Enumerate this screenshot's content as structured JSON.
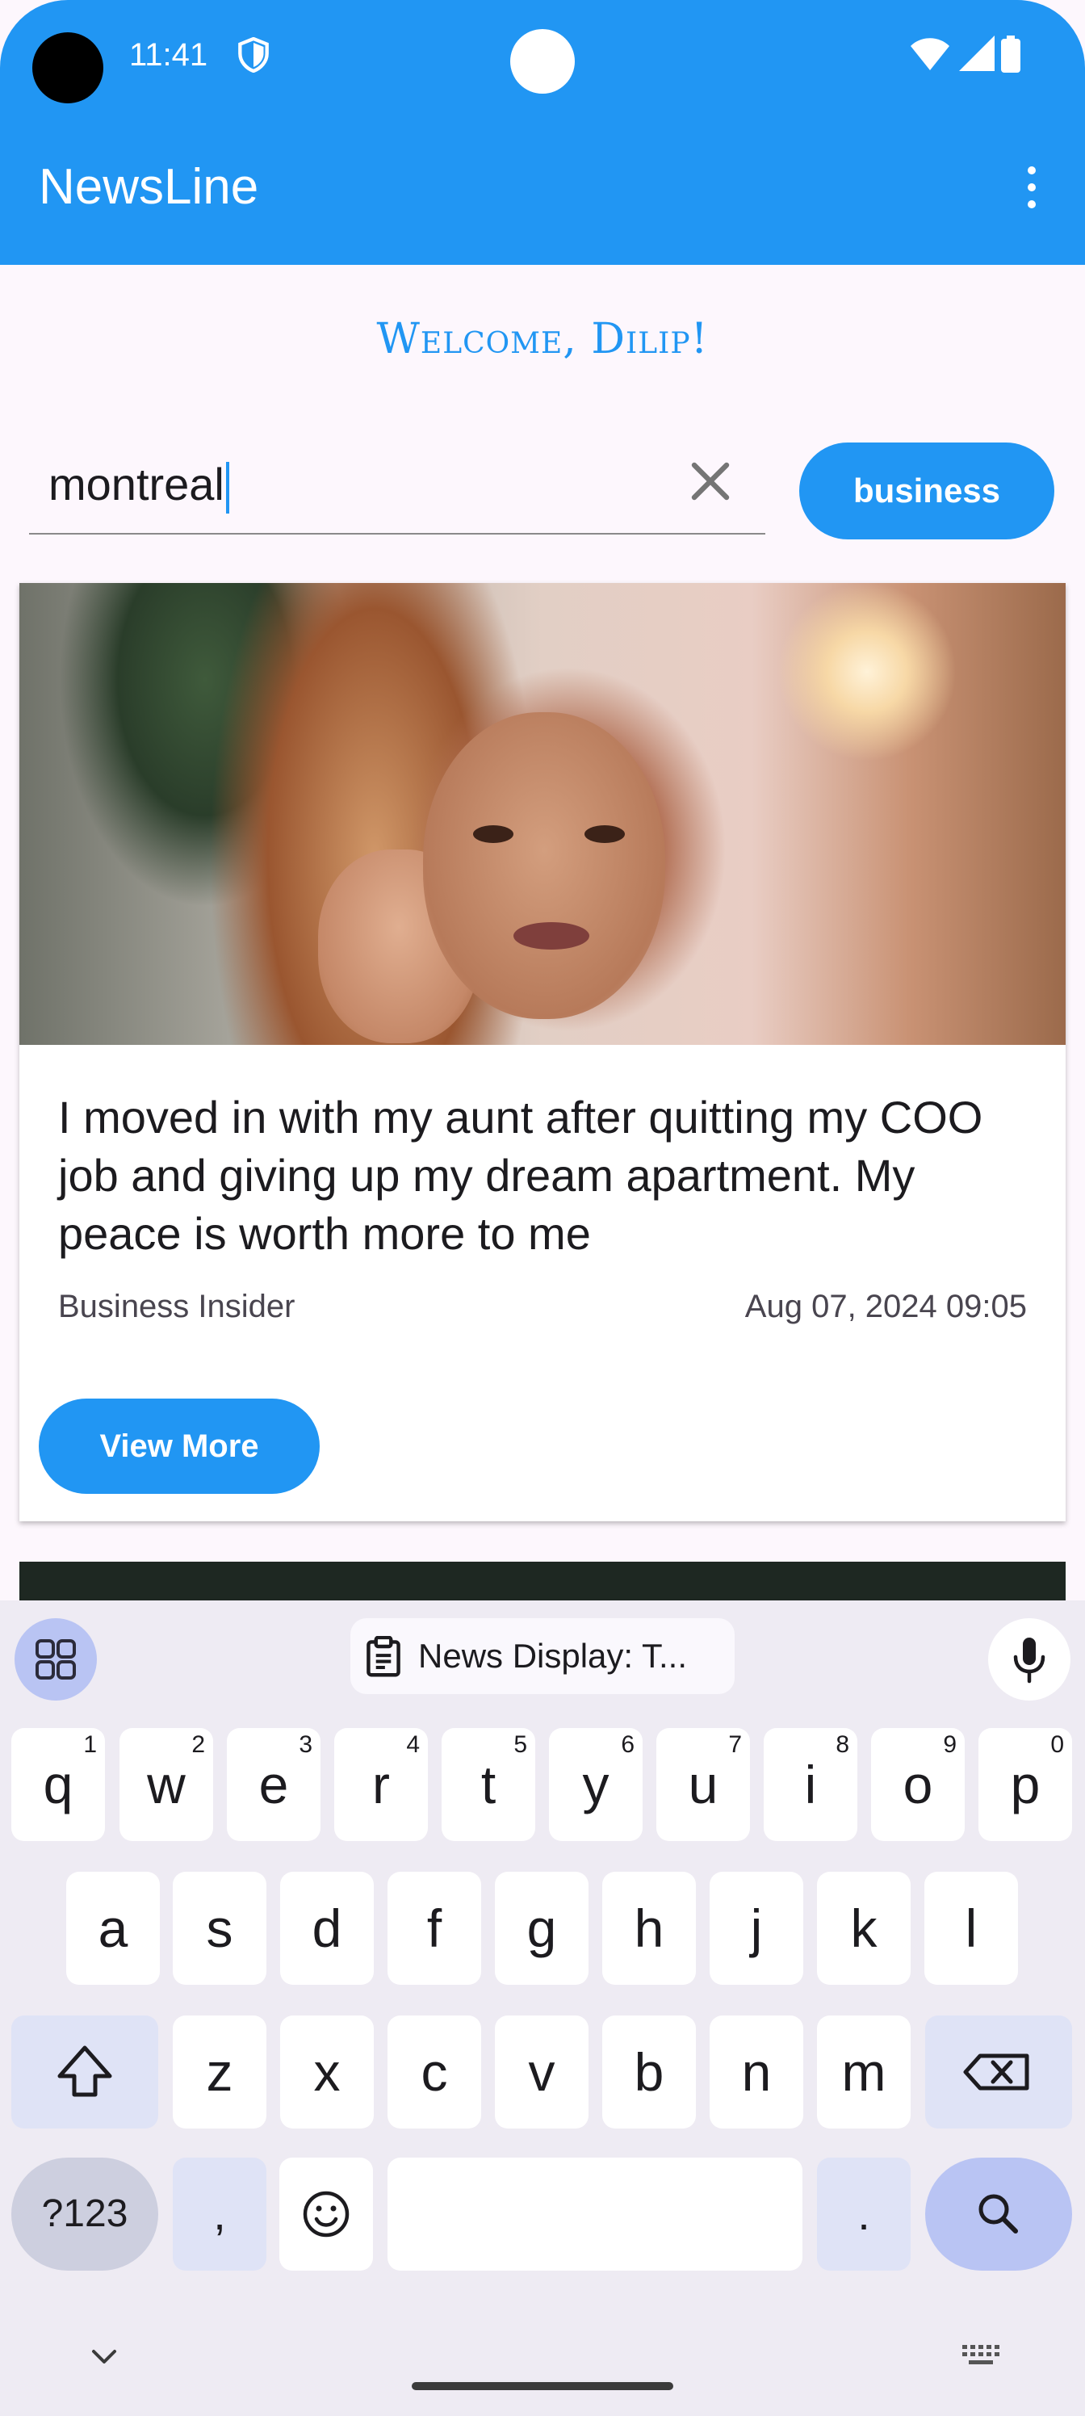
{
  "status_bar": {
    "time": "11:41"
  },
  "app_bar": {
    "title": "NewsLine"
  },
  "welcome": "Welcome, Dilip!",
  "search": {
    "value": "montreal"
  },
  "category_button": "business",
  "article": {
    "headline": "I moved in with my aunt after quitting my COO job and giving up my dream apartment. My peace is worth more to me",
    "source": "Business Insider",
    "date": "Aug 07, 2024 09:05",
    "button": "View More"
  },
  "keyboard": {
    "clipboard_suggestion": "News Display: T...",
    "row1": [
      {
        "key": "q",
        "hint": "1"
      },
      {
        "key": "w",
        "hint": "2"
      },
      {
        "key": "e",
        "hint": "3"
      },
      {
        "key": "r",
        "hint": "4"
      },
      {
        "key": "t",
        "hint": "5"
      },
      {
        "key": "y",
        "hint": "6"
      },
      {
        "key": "u",
        "hint": "7"
      },
      {
        "key": "i",
        "hint": "8"
      },
      {
        "key": "o",
        "hint": "9"
      },
      {
        "key": "p",
        "hint": "0"
      }
    ],
    "row2": [
      "a",
      "s",
      "d",
      "f",
      "g",
      "h",
      "j",
      "k",
      "l"
    ],
    "row3": [
      "z",
      "x",
      "c",
      "v",
      "b",
      "n",
      "m"
    ],
    "symbols_key": "?123",
    "comma": ",",
    "period": "."
  },
  "colors": {
    "primary": "#2196f3",
    "background": "#fdf7fd",
    "keyboard_bg": "#eeebf3"
  },
  "icons": [
    "shield-icon",
    "wifi-icon",
    "signal-icon",
    "battery-icon",
    "more-vert-icon",
    "clear-icon",
    "apps-grid-icon",
    "clipboard-icon",
    "mic-icon",
    "shift-icon",
    "backspace-icon",
    "emoji-icon",
    "search-icon",
    "chevron-down-icon",
    "keyboard-icon"
  ]
}
